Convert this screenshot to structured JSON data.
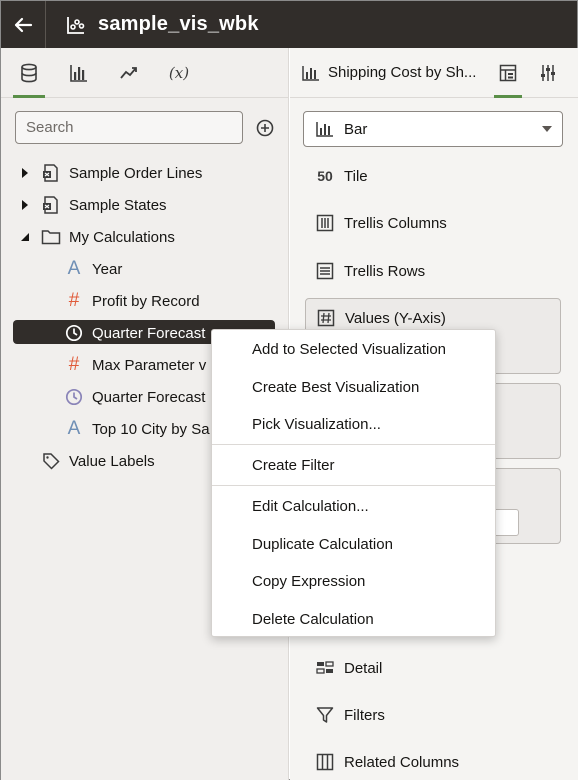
{
  "app": {
    "title": "sample_vis_wbk"
  },
  "data_panel": {
    "tabs": [
      "data-icon",
      "visualizations-icon",
      "analytics-icon",
      "(x)"
    ],
    "search": {
      "placeholder": "Search",
      "value": ""
    },
    "tree": [
      {
        "label": "Sample Order Lines",
        "icon": "dataset-icon",
        "expanded": false
      },
      {
        "label": "Sample States",
        "icon": "dataset-icon",
        "expanded": false
      },
      {
        "label": "My Calculations",
        "icon": "folder-icon",
        "expanded": true
      },
      {
        "label": "Year",
        "icon": "attribute-icon"
      },
      {
        "label": "Profit by Record",
        "icon": "measure-icon"
      },
      {
        "label": "Quarter Forecast",
        "icon": "time-icon",
        "selected": true
      },
      {
        "label": "Max Parameter v",
        "icon": "measure-icon"
      },
      {
        "label": "Quarter Forecast",
        "icon": "time-icon"
      },
      {
        "label": "Top 10 City by Sa",
        "icon": "attribute-icon"
      },
      {
        "label": "Value Labels",
        "icon": "tag-icon"
      }
    ]
  },
  "viz_panel": {
    "title": "Shipping Cost by Sh...",
    "type": "Bar",
    "sections": {
      "tile": "Tile",
      "trellis_columns": "Trellis Columns",
      "trellis_rows": "Trellis Rows",
      "values_y": "Values (Y-Axis)",
      "detail": "Detail",
      "filters": "Filters",
      "related_columns": "Related Columns"
    }
  },
  "context_menu": {
    "items": [
      "Add to Selected Visualization",
      "Create Best Visualization",
      "Pick Visualization...",
      "Create Filter",
      "Edit Calculation...",
      "Duplicate Calculation",
      "Copy Expression",
      "Delete Calculation"
    ]
  },
  "colors": {
    "header_bg": "#312d2a",
    "accent_green": "#5a8f48",
    "measure_orange": "#e05b3a",
    "attribute_blue": "#6f8fb5",
    "time_purple": "#8a84b8"
  }
}
